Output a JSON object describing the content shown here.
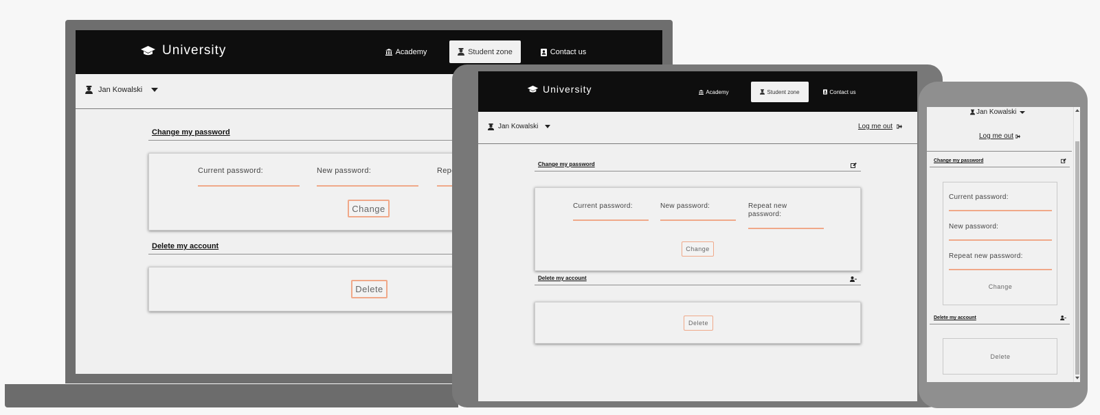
{
  "app": {
    "brand": "University",
    "nav": [
      {
        "label": "Academy",
        "icon": "building-icon"
      },
      {
        "label": "Student zone",
        "icon": "student-icon",
        "active": true
      },
      {
        "label": "Contact us",
        "icon": "contact-icon"
      }
    ]
  },
  "user": {
    "name": "Jan Kowalski",
    "logout": "Log me out"
  },
  "password_section": {
    "title": "Change my password",
    "current_label": "Current password:",
    "new_label": "New password:",
    "repeat_label": "Repeat new password:",
    "repeat_label_cut": "Repe",
    "button": "Change"
  },
  "delete_section": {
    "title": "Delete my account",
    "button": "Delete"
  },
  "colors": {
    "nav_bg": "#0e0e0e",
    "accent": "#f0a888",
    "device_laptop": "#6e6e6e",
    "device_tablet": "#787878",
    "device_phone": "#8f8f8f"
  }
}
